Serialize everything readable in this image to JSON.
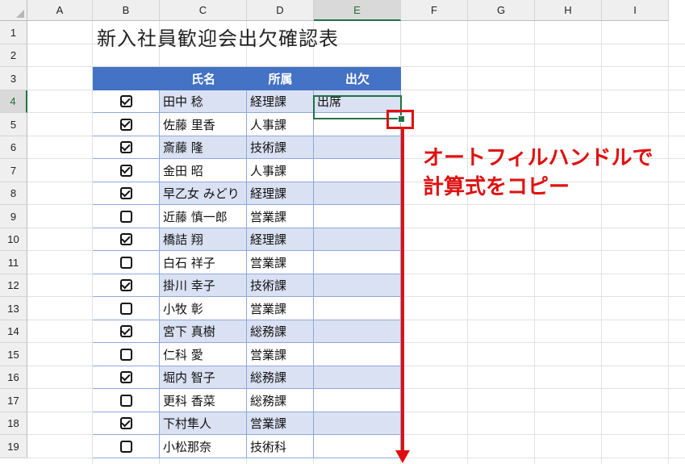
{
  "sheet": {
    "columns": [
      "A",
      "B",
      "C",
      "D",
      "E",
      "F",
      "G",
      "H",
      "I"
    ],
    "rows": [
      "1",
      "2",
      "3",
      "4",
      "5",
      "6",
      "7",
      "8",
      "9",
      "10",
      "11",
      "12",
      "13",
      "14",
      "15",
      "16",
      "17",
      "18",
      "19"
    ],
    "selected_column": "E",
    "selected_row": "4"
  },
  "title": "新入社員歓迎会出欠確認表",
  "table": {
    "headers": {
      "name": "氏名",
      "dept": "所属",
      "attendance": "出欠"
    },
    "rows": [
      {
        "checked": true,
        "name": "田中  稔",
        "dept": "経理課",
        "attendance": "出席"
      },
      {
        "checked": true,
        "name": "佐藤  里香",
        "dept": "人事課",
        "attendance": ""
      },
      {
        "checked": true,
        "name": "斎藤  隆",
        "dept": "技術課",
        "attendance": ""
      },
      {
        "checked": true,
        "name": "金田  昭",
        "dept": "人事課",
        "attendance": ""
      },
      {
        "checked": true,
        "name": "早乙女  みどり",
        "dept": "経理課",
        "attendance": ""
      },
      {
        "checked": false,
        "name": "近藤  慎一郎",
        "dept": "営業課",
        "attendance": ""
      },
      {
        "checked": true,
        "name": "橋詰  翔",
        "dept": "経理課",
        "attendance": ""
      },
      {
        "checked": false,
        "name": "白石  祥子",
        "dept": "営業課",
        "attendance": ""
      },
      {
        "checked": true,
        "name": "掛川  幸子",
        "dept": "技術課",
        "attendance": ""
      },
      {
        "checked": false,
        "name": "小牧  彰",
        "dept": "営業課",
        "attendance": ""
      },
      {
        "checked": true,
        "name": "宮下  真樹",
        "dept": "総務課",
        "attendance": ""
      },
      {
        "checked": false,
        "name": "仁科  愛",
        "dept": "営業課",
        "attendance": ""
      },
      {
        "checked": true,
        "name": "堀内  智子",
        "dept": "総務課",
        "attendance": ""
      },
      {
        "checked": false,
        "name": "更科  香菜",
        "dept": "総務課",
        "attendance": ""
      },
      {
        "checked": true,
        "name": "下村隼人",
        "dept": "営業課",
        "attendance": ""
      },
      {
        "checked": false,
        "name": "小松那奈",
        "dept": "技術科",
        "attendance": ""
      }
    ]
  },
  "callout": {
    "line1": "オートフィルハンドルで",
    "line2": "計算式をコピー"
  },
  "colors": {
    "header_bg": "#4472c4",
    "band_bg": "#d9e1f2",
    "accent": "#e01010",
    "selection": "#217346"
  }
}
